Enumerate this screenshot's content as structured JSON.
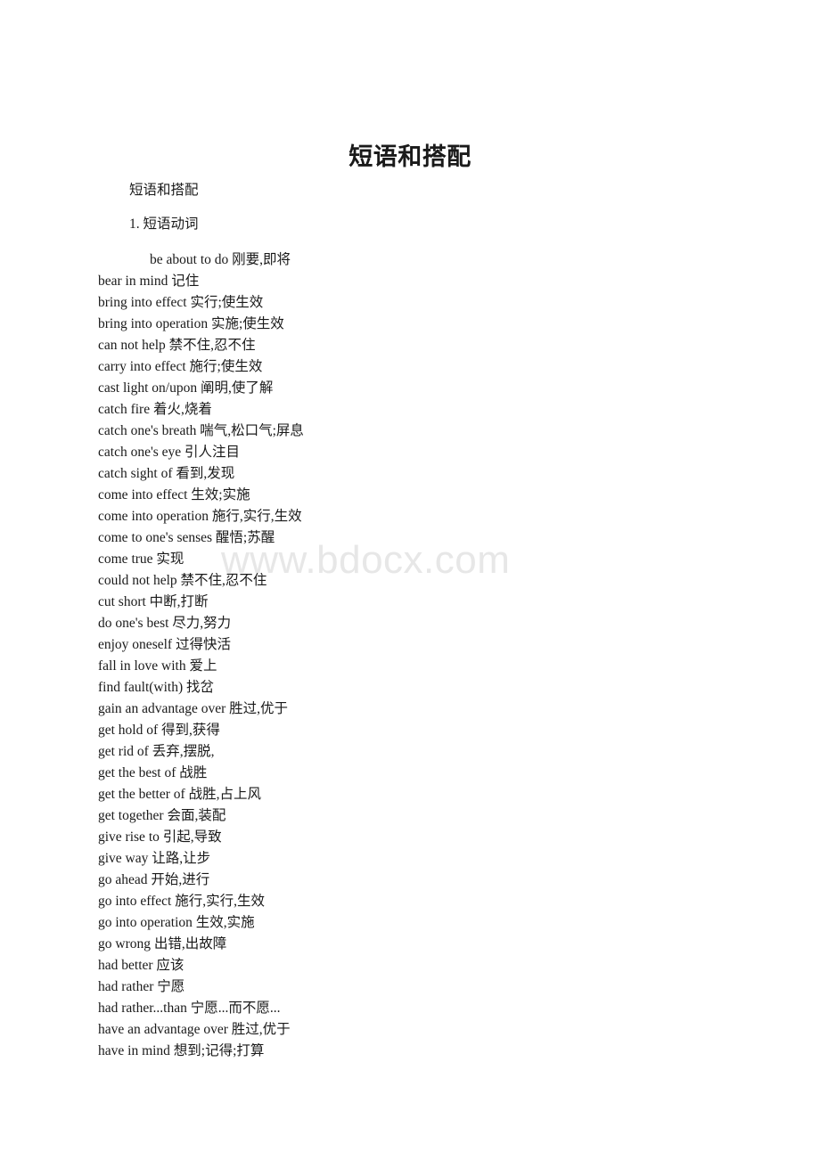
{
  "page": {
    "background_color": "#ffffff",
    "text_color": "#1a1a1a"
  },
  "watermark": {
    "text": "www.bdocx.com",
    "color": "#e7e7e7"
  },
  "document": {
    "title": "短语和搭配",
    "heading": "短语和搭配",
    "section": "1. 短语动词",
    "entries": [
      {
        "text": "be about to do 刚要,即将",
        "indented": true
      },
      {
        "text": "bear in mind 记住",
        "indented": false
      },
      {
        "text": "bring into effect 实行;使生效",
        "indented": false
      },
      {
        "text": "bring into operation 实施;使生效",
        "indented": false
      },
      {
        "text": "can not help 禁不住,忍不住",
        "indented": false
      },
      {
        "text": "carry into effect 施行;使生效",
        "indented": false
      },
      {
        "text": "cast light on/upon 阐明,使了解",
        "indented": false
      },
      {
        "text": "catch fire 着火,烧着",
        "indented": false
      },
      {
        "text": "catch one's breath 喘气,松口气;屏息",
        "indented": false
      },
      {
        "text": "catch one's eye 引人注目",
        "indented": false
      },
      {
        "text": "catch sight of 看到,发现",
        "indented": false
      },
      {
        "text": "come into effect 生效;实施",
        "indented": false
      },
      {
        "text": "come into operation 施行,实行,生效",
        "indented": false
      },
      {
        "text": "come to one's senses 醒悟;苏醒",
        "indented": false
      },
      {
        "text": "come true 实现",
        "indented": false
      },
      {
        "text": "could not help 禁不住,忍不住",
        "indented": false
      },
      {
        "text": "cut short 中断,打断",
        "indented": false
      },
      {
        "text": "do one's best 尽力,努力",
        "indented": false
      },
      {
        "text": "enjoy oneself 过得快活",
        "indented": false
      },
      {
        "text": "fall in love with 爱上",
        "indented": false
      },
      {
        "text": "find fault(with) 找岔",
        "indented": false
      },
      {
        "text": "gain an advantage over 胜过,优于",
        "indented": false
      },
      {
        "text": "get hold of 得到,获得",
        "indented": false
      },
      {
        "text": "get rid of 丢弃,摆脱,",
        "indented": false
      },
      {
        "text": "get the best of 战胜",
        "indented": false
      },
      {
        "text": "get the better of 战胜,占上风",
        "indented": false
      },
      {
        "text": "get together 会面,装配",
        "indented": false
      },
      {
        "text": "give rise to 引起,导致",
        "indented": false
      },
      {
        "text": "give way 让路,让步",
        "indented": false
      },
      {
        "text": "go ahead 开始,进行",
        "indented": false
      },
      {
        "text": "go into effect 施行,实行,生效",
        "indented": false
      },
      {
        "text": "go into operation 生效,实施",
        "indented": false
      },
      {
        "text": "go wrong 出错,出故障",
        "indented": false
      },
      {
        "text": "had better 应该",
        "indented": false
      },
      {
        "text": "had rather 宁愿",
        "indented": false
      },
      {
        "text": "had rather...than 宁愿...而不愿...",
        "indented": false
      },
      {
        "text": "have an advantage over 胜过,优于",
        "indented": false
      },
      {
        "text": "have in mind 想到;记得;打算",
        "indented": false
      }
    ]
  }
}
